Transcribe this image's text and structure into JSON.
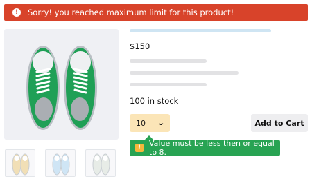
{
  "alert": {
    "icon": "exclamation-circle-icon",
    "message": "Sorry! you reached maximum limit for this product!",
    "color": "#d8432a"
  },
  "product": {
    "image_icon": "sneaker-top-view-icon",
    "thumbnails": [
      {
        "name": "thumbnail-beige-sneaker",
        "color": "#f1dfb6"
      },
      {
        "name": "thumbnail-blue-sneaker",
        "color": "#cfe5f5"
      },
      {
        "name": "thumbnail-white-sneaker",
        "color": "#e7ece7"
      }
    ],
    "price": "$150",
    "stock": "100 in stock"
  },
  "quantity": {
    "value": "10",
    "icon": "chevron-down-icon"
  },
  "add_to_cart": {
    "label": "Add to Cart"
  },
  "validation": {
    "icon": "warning-icon",
    "message": "Value must be less then or equal to 8.",
    "color": "#28a353"
  }
}
